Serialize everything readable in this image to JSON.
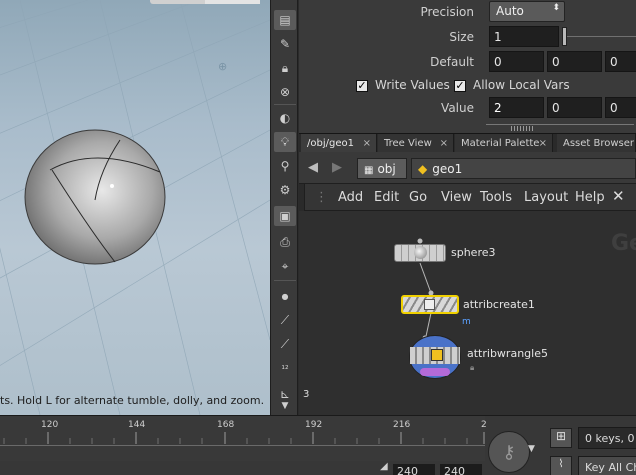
{
  "viewport": {
    "status_message": "ts. Hold L for alternate tumble, dolly, and zoom."
  },
  "params": {
    "precision_label": "Precision",
    "precision_value": "Auto",
    "size_label": "Size",
    "size_value": "1",
    "default_label": "Default",
    "default_values": [
      "0",
      "0",
      "0"
    ],
    "write_values_label": "Write Values",
    "write_values_checked": true,
    "allow_local_vars_label": "Allow Local Vars",
    "allow_local_vars_checked": true,
    "value_label": "Value",
    "value_values": [
      "2",
      "0",
      "0"
    ]
  },
  "tabs": [
    {
      "label": "/obj/geo1",
      "close": "×"
    },
    {
      "label": "Tree View",
      "close": "×"
    },
    {
      "label": "Material Palette",
      "close": "×"
    },
    {
      "label": "Asset Browser",
      "close": ""
    }
  ],
  "path": {
    "obj_label": "obj",
    "geo_label": "geo1"
  },
  "menu": [
    "Add",
    "Edit",
    "Go",
    "View",
    "Tools",
    "Layout",
    "Help"
  ],
  "network": {
    "watermark": "Ge",
    "nodes": [
      {
        "name": "sphere3"
      },
      {
        "name": "attribcreate1",
        "flag": "m"
      },
      {
        "name": "attribwrangle5"
      }
    ],
    "left_number": "3"
  },
  "timeline": {
    "tick_labels": [
      "120",
      "144",
      "168",
      "192",
      "216",
      "2"
    ],
    "start_frame": "240",
    "end_frame": "240",
    "key_info": "0 keys, 0",
    "key_all": "Key All Ch"
  },
  "colors": {
    "selected_node_outline": "#f0d000",
    "network_bg": "#2f2f2f",
    "panel_bg": "#3a3a3a"
  }
}
